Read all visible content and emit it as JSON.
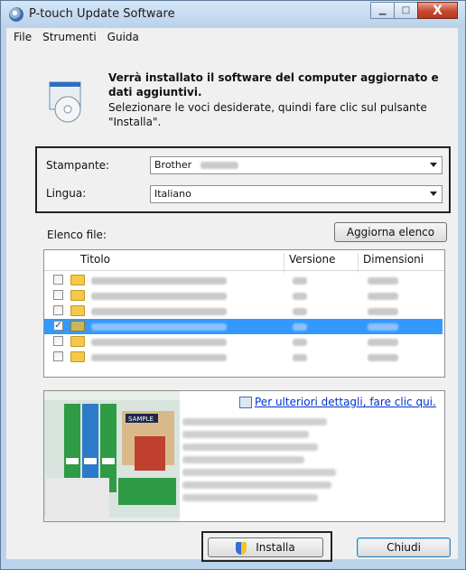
{
  "window": {
    "title": "P-touch Update Software",
    "close_symbol": "X",
    "min_symbol": "▁",
    "max_symbol": "□"
  },
  "menu": [
    "File",
    "Strumenti",
    "Guida"
  ],
  "header": {
    "bold_text": "Verrà installato il software del computer aggiornato e dati aggiuntivi.",
    "sub_text": "Selezionare le voci desiderate, quindi fare clic sul pulsante \"Installa\"."
  },
  "settings": {
    "printer_label": "Stampante:",
    "printer_value": "Brother",
    "language_label": "Lingua:",
    "language_value": "Italiano"
  },
  "files": {
    "label": "Elenco file:",
    "refresh_button": "Aggiorna elenco",
    "columns": [
      "Titolo",
      "Versione",
      "Dimensioni"
    ],
    "rows": [
      {
        "checked": false,
        "selected": false
      },
      {
        "checked": false,
        "selected": false
      },
      {
        "checked": false,
        "selected": false
      },
      {
        "checked": true,
        "selected": true
      },
      {
        "checked": false,
        "selected": false
      },
      {
        "checked": false,
        "selected": false
      }
    ],
    "check_mark": "✓"
  },
  "info": {
    "link": "Per ulteriori dettagli, fare clic qui.",
    "sample_label": "SAMPLE"
  },
  "buttons": {
    "install": "Installa",
    "close": "Chiudi"
  },
  "icons": {
    "app": "ptouch-app-icon",
    "header": "software-disc-icon",
    "install": "shield-icon",
    "link": "info-window-icon"
  }
}
